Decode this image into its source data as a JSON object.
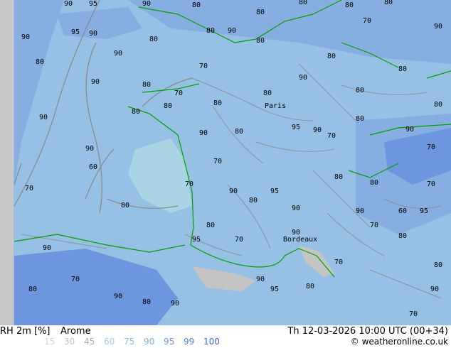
{
  "title": {
    "variable": "RH 2m [%]",
    "model": "Arome",
    "valid_time": "Th 12-03-2026 10:00 UTC (00+34)"
  },
  "legend": {
    "items": [
      {
        "value": "15",
        "color": "#d6d6d6"
      },
      {
        "value": "30",
        "color": "#c4c4c4"
      },
      {
        "value": "45",
        "color": "#b0b0b0"
      },
      {
        "value": "60",
        "color": "#a6d0e6"
      },
      {
        "value": "75",
        "color": "#96c0e4"
      },
      {
        "value": "90",
        "color": "#86aee0"
      },
      {
        "value": "95",
        "color": "#6e96de"
      },
      {
        "value": "99",
        "color": "#5a82dc"
      },
      {
        "value": "100",
        "color": "#3c64d8"
      }
    ]
  },
  "copyright": "© weatheronline.co.uk",
  "map": {
    "colors": {
      "sea": "#96c0e4",
      "humid": "#86aee0",
      "very_humid": "#6e96de",
      "dry": "#a8d4e4",
      "land_dry": "#c4c4c4",
      "coast": "#00a000",
      "contour": "#888888",
      "offmap": "#c8c8c8"
    },
    "contour_labels": [
      "90",
      "95",
      "90",
      "90",
      "95",
      "90",
      "90",
      "80",
      "90",
      "80",
      "80",
      "80",
      "90",
      "80",
      "80",
      "80",
      "70",
      "80",
      "80",
      "70",
      "80",
      "70",
      "80",
      "80",
      "90",
      "80",
      "90",
      "80",
      "80",
      "90",
      "80",
      "80",
      "90",
      "70",
      "70",
      "80",
      "90",
      "95",
      "90",
      "80",
      "90",
      "70",
      "60",
      "80",
      "70",
      "90",
      "80",
      "95",
      "90",
      "70",
      "80",
      "80",
      "60",
      "70",
      "80",
      "90",
      "95",
      "90",
      "80",
      "70",
      "90",
      "80",
      "90",
      "95",
      "80",
      "70",
      "90",
      "95",
      "90",
      "80",
      "70",
      "70",
      "80",
      "70",
      "90",
      "80"
    ],
    "city_labels": [
      "Paris",
      "Bordeaux"
    ]
  }
}
